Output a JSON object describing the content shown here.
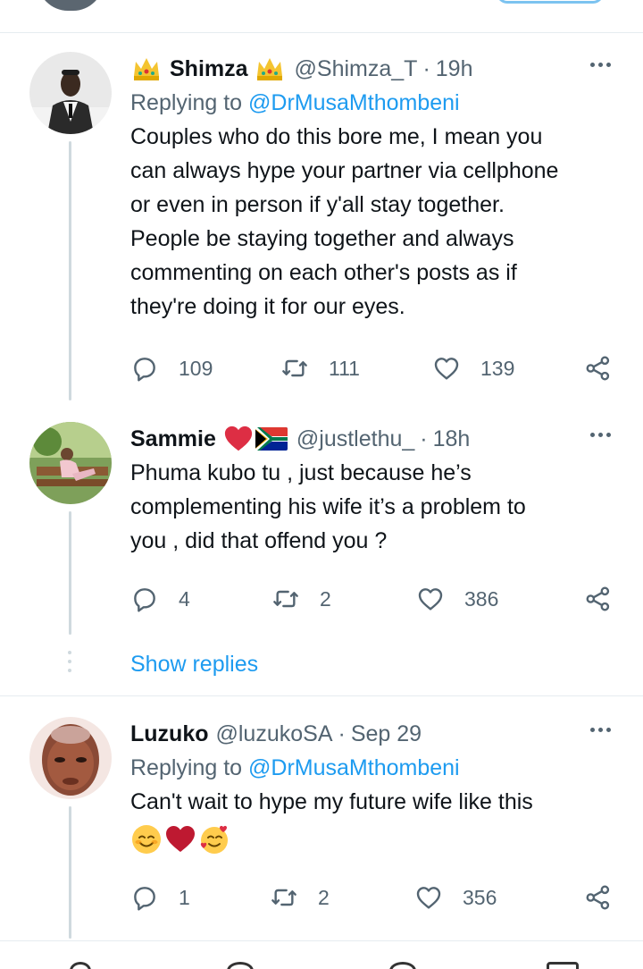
{
  "tweets": [
    {
      "name": "Shimza",
      "handle": "@Shimza_T",
      "time": "19h",
      "reply_label": "Replying to",
      "reply_to": "@DrMusaMthombeni",
      "text": "Couples who do this bore me, I mean you\ncan always hype your partner via cellphone\nor even in person if y'all stay together.\nPeople be staying together and always\ncommenting on each other's posts as if\nthey're doing it for our eyes.",
      "replies": "109",
      "retweets": "111",
      "likes": "139"
    },
    {
      "name": "Sammie",
      "handle": "@justlethu_",
      "time": "18h",
      "text": "Phuma kubo tu , just because he’s\ncomplementing his wife it’s a problem to\nyou , did that offend you ?",
      "replies": "4",
      "retweets": "2",
      "likes": "386"
    },
    {
      "name": "Luzuko",
      "handle": "@luzukoSA",
      "time": "Sep 29",
      "reply_label": "Replying to",
      "reply_to": "@DrMusaMthombeni",
      "text": "Can't wait to hype my future wife like this",
      "replies": "1",
      "retweets": "2",
      "likes": "356"
    }
  ],
  "show_replies": "Show replies",
  "dot_separator": "·",
  "icons": [
    "crown-emoji",
    "heart-emoji",
    "south-africa-flag",
    "reply-icon",
    "retweet-icon",
    "like-icon",
    "share-icon",
    "more-icon",
    "smiling-face-emoji",
    "smiling-face-with-hearts-emoji"
  ],
  "colors": {
    "link": "#1d9bf0",
    "muted": "#536471",
    "text": "#0f1419",
    "divider": "#e6ecf0",
    "thread": "#cfd9de"
  }
}
